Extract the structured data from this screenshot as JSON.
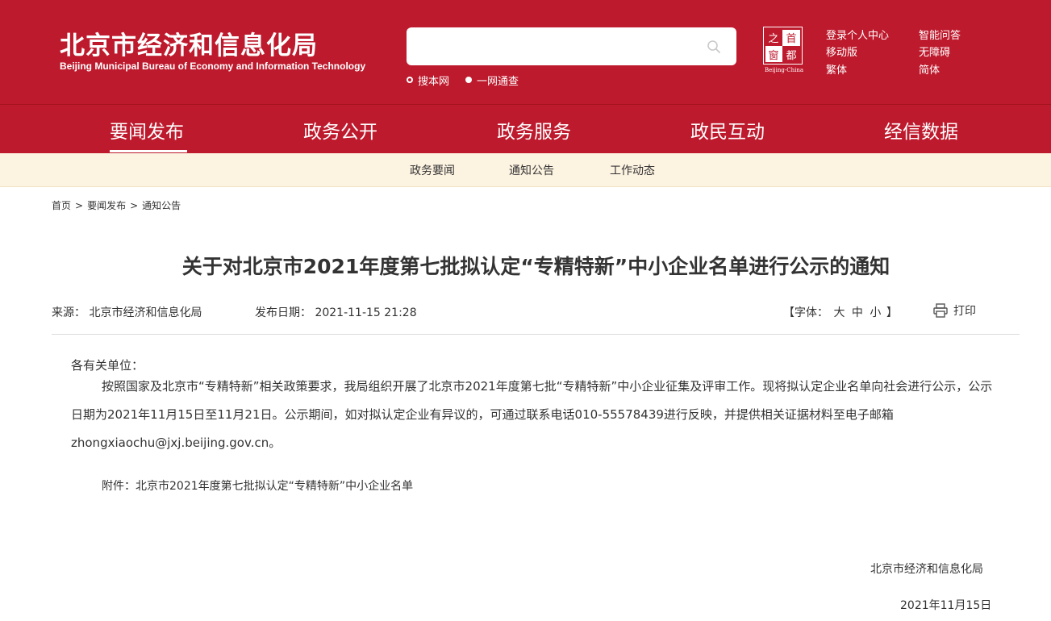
{
  "header": {
    "logo_cn": "北京市经济和信息化局",
    "logo_en": "Beijing Municipal Bureau of Economy and Information Technology",
    "search": {
      "placeholder": "",
      "value": ""
    },
    "search_scope": [
      "搜本网",
      "一网通查"
    ],
    "seal": {
      "chars": [
        "之",
        "首",
        "都",
        "窗"
      ],
      "caption": "Beijing-China"
    },
    "links": [
      "登录个人中心",
      "智能问答",
      "移动版",
      "无障碍",
      "繁体",
      "简体"
    ]
  },
  "nav": {
    "items": [
      "要闻发布",
      "政务公开",
      "政务服务",
      "政民互动",
      "经信数据"
    ],
    "active": "要闻发布"
  },
  "subnav": {
    "items": [
      "政务要闻",
      "通知公告",
      "工作动态"
    ]
  },
  "breadcrumb": [
    "首页",
    "要闻发布",
    "通知公告"
  ],
  "breadcrumb_sep": ">",
  "article": {
    "title": "关于对北京市2021年度第七批拟认定“专精特新”中小企业名单进行公示的通知",
    "source_label": "来源：",
    "source": "北京市经济和信息化局",
    "date_label": "发布日期：",
    "date": "2021-11-15 21:28",
    "font_label": "【字体：",
    "font_sizes": [
      "大",
      "中",
      "小"
    ],
    "font_close": "】",
    "print_label": "打印",
    "salutation": "各有关单位：",
    "paragraph": "按照国家及北京市“专精特新”相关政策要求，我局组织开展了北京市2021年度第七批“专精特新”中小企业征集及评审工作。现将拟认定企业名单向社会进行公示，公示日期为2021年11月15日至11月21日。公示期间，如对拟认定企业有异议的，可通过联系电话010-55578439进行反映，并提供相关证据材料至电子邮箱zhongxiaochu@jxj.beijing.gov.cn。",
    "attachment": "附件：北京市2021年度第七批拟认定“专精特新”中小企业名单",
    "sign_org": "北京市经济和信息化局",
    "sign_date": "2021年11月15日"
  },
  "colors": {
    "brand_red": "#be1a2d",
    "subnav_bg": "#fdf3e1",
    "text": "#333333"
  }
}
